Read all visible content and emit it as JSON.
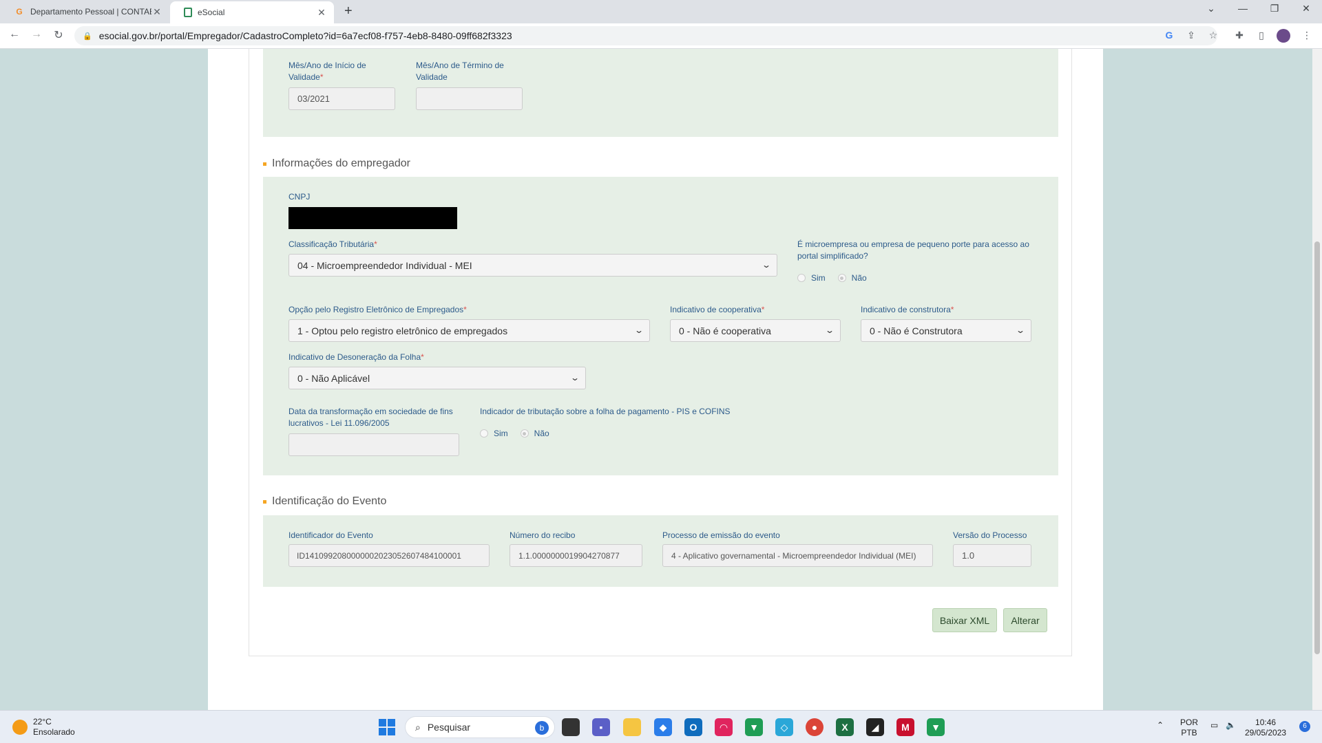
{
  "browser": {
    "tabs": [
      {
        "title": "Departamento Pessoal | CONTAB",
        "favicon": "G",
        "active": false
      },
      {
        "title": "eSocial",
        "favicon": "doc",
        "active": true
      }
    ],
    "url": "esocial.gov.br/portal/Empregador/CadastroCompleto?id=6a7ecf08-f757-4eb8-8480-09ff682f3323"
  },
  "validade": {
    "inicio_label": "Mês/Ano de Início de Validade",
    "inicio_value": "03/2021",
    "termino_label": "Mês/Ano de Término de Validade",
    "termino_value": ""
  },
  "empregador": {
    "section_title": "Informações do empregador",
    "cnpj_label": "CNPJ",
    "classificacao_label": "Classificação Tributária",
    "classificacao_value": "04 - Microempreendedor Individual - MEI",
    "microempresa_label": "É microempresa ou empresa de pequeno porte para acesso ao portal simplificado?",
    "microempresa_sim": "Sim",
    "microempresa_nao": "Não",
    "registro_label": "Opção pelo Registro Eletrônico de Empregados",
    "registro_value": "1 - Optou pelo registro eletrônico de empregados",
    "cooperativa_label": "Indicativo de cooperativa",
    "cooperativa_value": "0 - Não é cooperativa",
    "construtora_label": "Indicativo de construtora",
    "construtora_value": "0 - Não é Construtora",
    "desoneracao_label": "Indicativo de Desoneração da Folha",
    "desoneracao_value": "0 - Não Aplicável",
    "transformacao_label": "Data da transformação em sociedade de fins lucrativos - Lei 11.096/2005",
    "transformacao_value": "",
    "pis_label": "Indicador de tributação sobre a folha de pagamento - PIS e COFINS",
    "pis_sim": "Sim",
    "pis_nao": "Não"
  },
  "evento": {
    "section_title": "Identificação do Evento",
    "id_label": "Identificador do Evento",
    "id_value": "ID1410992080000002023052607484100001",
    "recibo_label": "Número do recibo",
    "recibo_value": "1.1.0000000019904270877",
    "processo_label": "Processo de emissão do evento",
    "processo_value": "4 - Aplicativo governamental - Microempreendedor Individual (MEI)",
    "versao_label": "Versão do Processo",
    "versao_value": "1.0"
  },
  "actions": {
    "baixar": "Baixar XML",
    "alterar": "Alterar"
  },
  "taskbar": {
    "temperature": "22°C",
    "weather": "Ensolarado",
    "search_placeholder": "Pesquisar",
    "lang1": "POR",
    "lang2": "PTB",
    "time": "10:46",
    "date": "29/05/2023",
    "notifications": "6"
  }
}
